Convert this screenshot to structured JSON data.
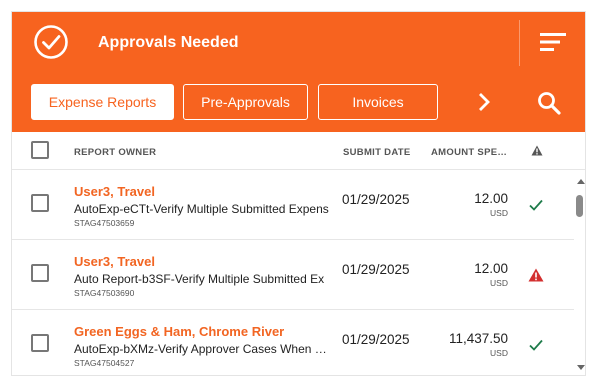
{
  "header": {
    "title": "Approvals Needed",
    "check_icon": "check-circle-icon",
    "filter_icon": "filter-lines-icon"
  },
  "tabs": [
    {
      "label": "Expense Reports",
      "active": true
    },
    {
      "label": "Pre-Approvals",
      "active": false
    },
    {
      "label": "Invoices",
      "active": false
    }
  ],
  "columns": {
    "owner": "REPORT OWNER",
    "date": "SUBMIT DATE",
    "amount": "AMOUNT SPE…"
  },
  "rows": [
    {
      "owner": "User3, Travel",
      "name": "AutoExp-eCTt-Verify Multiple Submitted Expens",
      "id": "STAG47503659",
      "date": "01/29/2025",
      "amount": "12.00",
      "currency": "USD",
      "status": "check"
    },
    {
      "owner": "User3, Travel",
      "name": "Auto Report-b3SF-Verify Multiple Submitted Ex",
      "id": "STAG47503690",
      "date": "01/29/2025",
      "amount": "12.00",
      "currency": "USD",
      "status": "warning"
    },
    {
      "owner": "Green Eggs & Ham, Chrome River",
      "name": "AutoExp-bXMz-Verify Approver Cases When …",
      "id": "STAG47504527",
      "date": "01/29/2025",
      "amount": "11,437.50",
      "currency": "USD",
      "status": "check"
    }
  ],
  "colors": {
    "brand": "#f7631f",
    "owner_text": "#f26522",
    "check": "#1e7b4a",
    "warning": "#d32f2f"
  }
}
